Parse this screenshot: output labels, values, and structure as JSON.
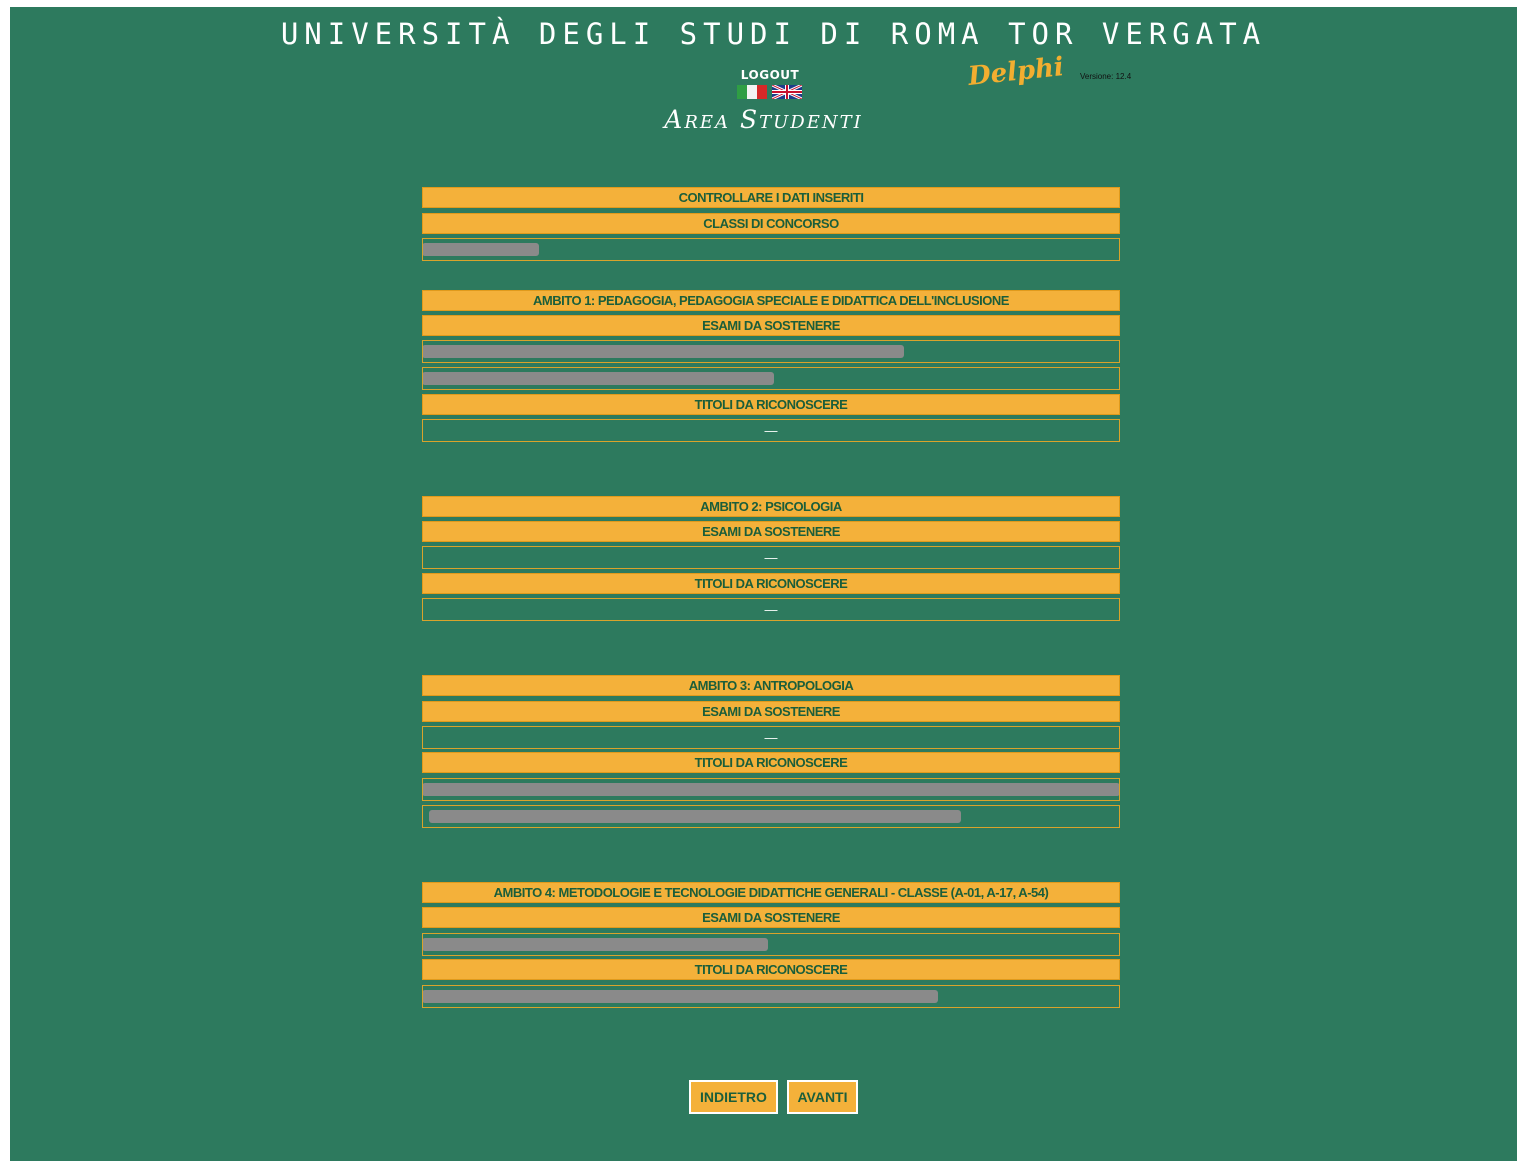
{
  "header": {
    "university": "UNIVERSITÀ DEGLI STUDI DI ROMA TOR VERGATA",
    "logout": "LOGOUT",
    "brand": "Delphi",
    "version": "Versione: 12.4",
    "area": "Area Studenti",
    "languages": [
      "italian-flag",
      "uk-flag"
    ]
  },
  "colors": {
    "background": "#2d7a5e",
    "accent": "#f4b13a",
    "text_dark": "#1b5e3a"
  },
  "summary": {
    "heading": "CONTROLLARE I DATI INSERITI",
    "classi_label": "CLASSI DI CONCORSO"
  },
  "ambiti": [
    {
      "title": "AMBITO 1: PEDAGOGIA, PEDAGOGIA SPECIALE E DIDATTICA DELL'INCLUSIONE",
      "esami_label": "ESAMI DA SOSTENERE",
      "titoli_label": "TITOLI DA RICONOSCERE",
      "titoli_value": "—"
    },
    {
      "title": "AMBITO 2: PSICOLOGIA",
      "esami_label": "ESAMI DA SOSTENERE",
      "esami_value": "—",
      "titoli_label": "TITOLI DA RICONOSCERE",
      "titoli_value": "—"
    },
    {
      "title": "AMBITO 3: ANTROPOLOGIA",
      "esami_label": "ESAMI DA SOSTENERE",
      "esami_value": "—",
      "titoli_label": "TITOLI DA RICONOSCERE"
    },
    {
      "title": "AMBITO 4: METODOLOGIE E TECNOLOGIE DIDATTICHE GENERALI - CLASSE (A-01, A-17, A-54)",
      "esami_label": "ESAMI DA SOSTENERE",
      "titoli_label": "TITOLI DA RICONOSCERE"
    }
  ],
  "buttons": {
    "back": "INDIETRO",
    "next": "AVANTI"
  }
}
